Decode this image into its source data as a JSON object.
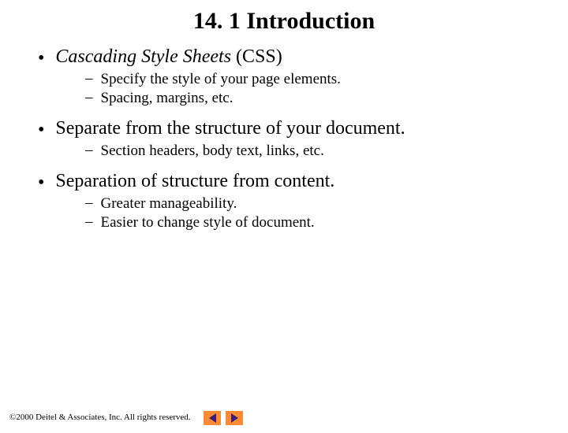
{
  "title": "14. 1 Introduction",
  "bullets": {
    "b1_italic": "Cascading Style Sheets",
    "b1_rest": " (CSS)",
    "b1_sub1": "Specify the style of your page elements.",
    "b1_sub2": "Spacing, margins, etc.",
    "b2": "Separate from the structure of your document.",
    "b2_sub1": "Section headers, body text, links, etc.",
    "b3": "Separation of structure from content.",
    "b3_sub1": "Greater manageability.",
    "b3_sub2": "Easier to change style of document."
  },
  "footer": {
    "copyright_symbol": "©",
    "text": " 2000 Deitel & Associates, Inc.  All rights reserved."
  }
}
